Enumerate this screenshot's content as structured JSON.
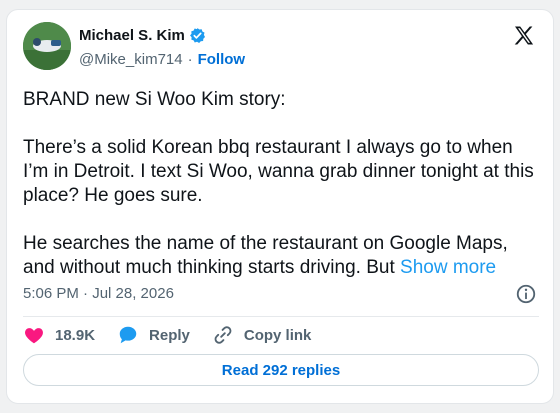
{
  "author": {
    "name": "Michael S. Kim",
    "handle": "@Mike_kim714",
    "separator": "·",
    "follow_label": "Follow",
    "verified": true
  },
  "tweet": {
    "paragraphs": [
      "BRAND new Si Woo Kim story:",
      "There’s a solid Korean bbq restaurant I always go to when I’m in Detroit. I text Si Woo, wanna grab dinner tonight at this place? He goes sure.",
      "He searches the name of the restaurant on Google Maps, and without much thinking starts driving. But"
    ],
    "show_more_label": "Show more",
    "timestamp": "5:06 PM · Jul 28, 2026"
  },
  "actions": {
    "likes": "18.9K",
    "reply_label": "Reply",
    "copy_link_label": "Copy link"
  },
  "read_replies_label": "Read 292 replies",
  "icons": [
    "verified-badge-icon",
    "x-logo-icon",
    "info-icon",
    "heart-icon",
    "reply-bubble-icon",
    "link-icon"
  ],
  "colors": {
    "link_blue": "#1d9bf0",
    "button_blue": "#006fd6",
    "heart_pink": "#f91880",
    "text_primary": "#0f1419",
    "text_secondary": "#536471"
  }
}
